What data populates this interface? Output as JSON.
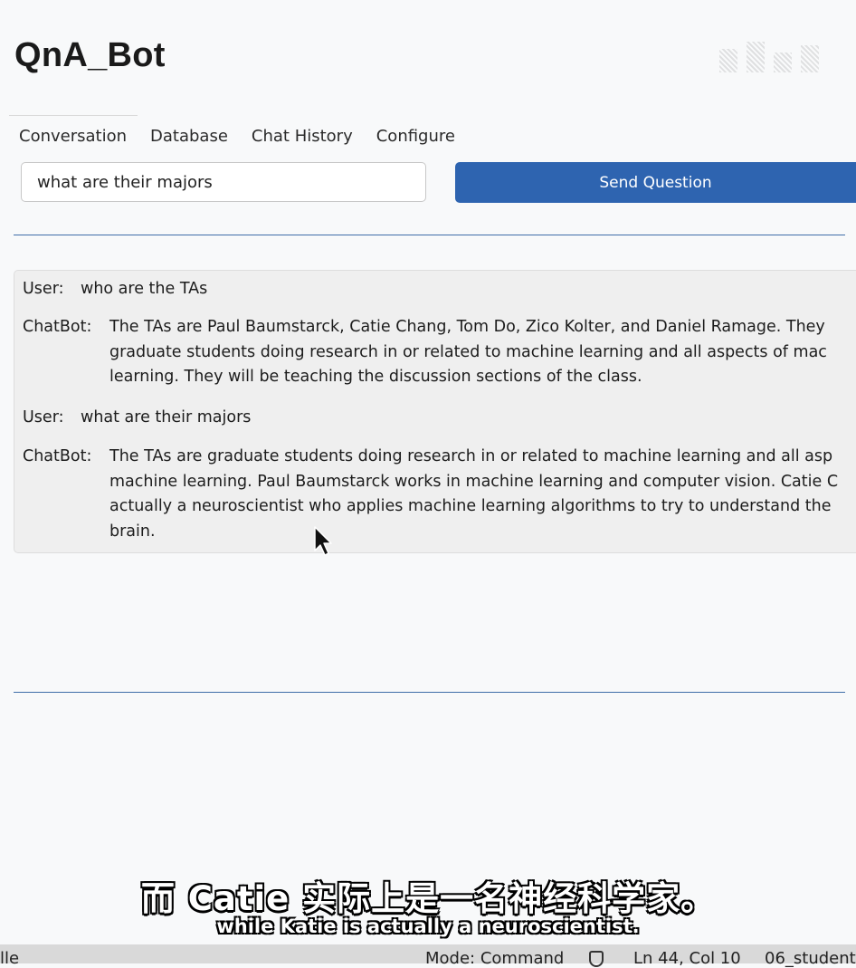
{
  "app": {
    "title": "QnA_Bot"
  },
  "tabs": [
    {
      "label": "Conversation",
      "active": true
    },
    {
      "label": "Database"
    },
    {
      "label": "Chat History"
    },
    {
      "label": "Configure"
    }
  ],
  "question": {
    "value": "what are their majors",
    "send_label": "Send Question"
  },
  "conversation": [
    {
      "speaker": "User:",
      "lines": [
        "who are the TAs"
      ]
    },
    {
      "speaker": "ChatBot:",
      "lines": [
        "The TAs are Paul Baumstarck, Catie Chang, Tom Do, Zico Kolter, and Daniel Ramage. They",
        "graduate students doing research in or related to machine learning and all aspects of mac",
        "learning. They will be teaching the discussion sections of the class."
      ]
    },
    {
      "speaker": "User:",
      "lines": [
        "what are their majors"
      ]
    },
    {
      "speaker": "ChatBot:",
      "lines": [
        "The TAs are graduate students doing research in or related to machine learning and all asp",
        "machine learning. Paul Baumstarck works in machine learning and computer vision. Catie C",
        "actually a neuroscientist who applies machine learning algorithms to try to understand the",
        "brain."
      ]
    }
  ],
  "subtitles": {
    "chinese": "而 Catie 实际上是一名神经科学家。",
    "english": "while Katie is actually a neuroscientist."
  },
  "statusbar": {
    "left": "lle",
    "mode": "Mode: Command",
    "position": "Ln 44, Col 10",
    "file": "06_student"
  },
  "colors": {
    "accent": "#2e64b0",
    "divider": "#3f6ea8",
    "panel": "#efefef"
  }
}
